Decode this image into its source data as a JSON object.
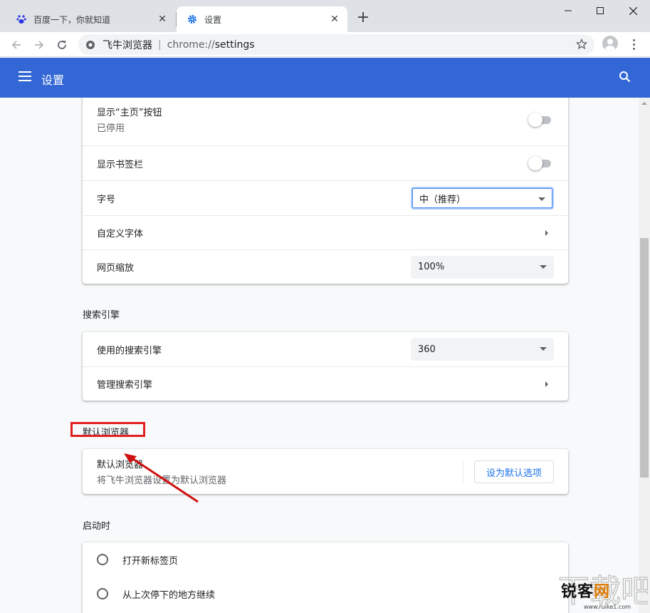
{
  "tabs": [
    {
      "title": "百度一下，你就知道",
      "icon": "baidu-paw-icon",
      "active": false
    },
    {
      "title": "设置",
      "icon": "gear-icon",
      "active": true
    }
  ],
  "toolbar": {
    "site_name": "飞牛浏览器",
    "url_scheme": "chrome://",
    "url_path": "settings"
  },
  "header": {
    "title": "设置"
  },
  "appearance": {
    "home_button": {
      "label": "显示“主页”按钮",
      "sublabel": "已停用",
      "enabled": false
    },
    "bookmarks_bar": {
      "label": "显示书签栏",
      "enabled": false
    },
    "font_size": {
      "label": "字号",
      "value": "中（推荐）"
    },
    "custom_fonts": {
      "label": "自定义字体"
    },
    "page_zoom": {
      "label": "网页缩放",
      "value": "100%"
    }
  },
  "search": {
    "title": "搜索引擎",
    "engine": {
      "label": "使用的搜索引擎",
      "value": "360"
    },
    "manage": {
      "label": "管理搜索引擎"
    }
  },
  "default_browser": {
    "title": "默认浏览器",
    "label": "默认浏览器",
    "sublabel": "将飞牛浏览器设置为默认浏览器",
    "button": "设为默认选项"
  },
  "startup": {
    "title": "启动时",
    "options": [
      {
        "label": "打开新标签页"
      },
      {
        "label": "从上次停下的地方继续"
      }
    ]
  },
  "watermark": {
    "brand_a": "锐客",
    "brand_b": "网",
    "sub": "www.ruike1.com"
  },
  "colors": {
    "header": "#3367d6",
    "highlight": "#e02020",
    "link": "#1a73e8"
  }
}
